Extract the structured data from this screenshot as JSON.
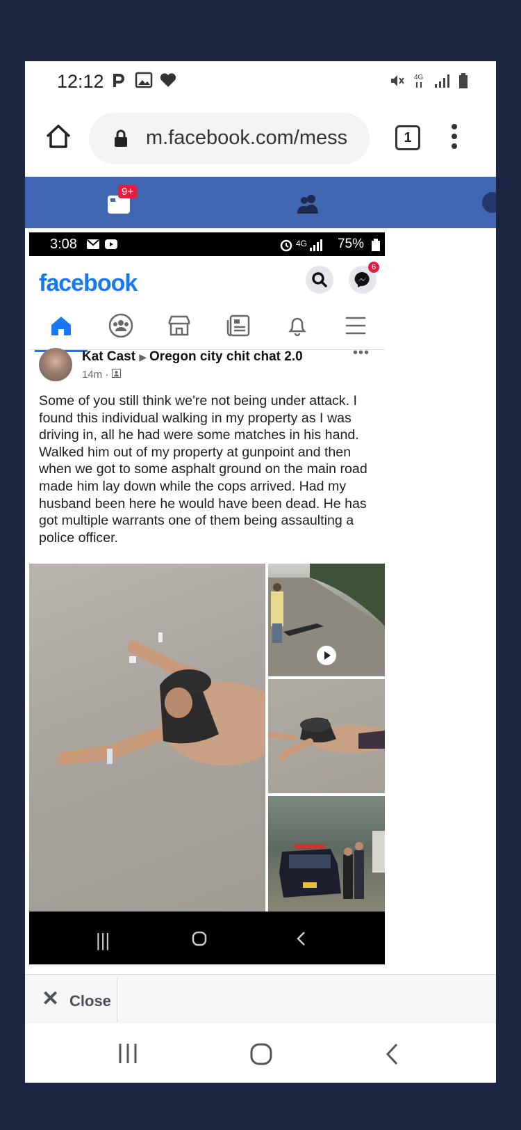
{
  "status_bar": {
    "time": "12:12"
  },
  "browser": {
    "url": "m.facebook.com/mess",
    "tab_count": "1"
  },
  "fb_nav": {
    "messages_badge": "9+"
  },
  "screenshot": {
    "status": {
      "time": "3:08",
      "battery": "75%"
    },
    "logo": "facebook",
    "messenger_badge": "6",
    "post": {
      "author": "Kat Cast",
      "group": "Oregon city chit chat 2.0",
      "time": "14m",
      "more": "•••",
      "text": "Some of you still think we're not being under attack. I found this individual walking in my property as I was driving in, all he had were some matches in his hand. Walked him out of my property at gunpoint and then when we got to some asphalt ground on the main road made him lay down while the cops arrived. Had my husband been here he would have been dead. He has got multiple warrants one of them being assaulting a police officer."
    }
  },
  "close_bar": {
    "label": "Close"
  },
  "colors": {
    "fb_blue": "#4267b2",
    "fb_brand": "#1877f2",
    "background": "#1c2541",
    "badge_red": "#e41e3f"
  }
}
